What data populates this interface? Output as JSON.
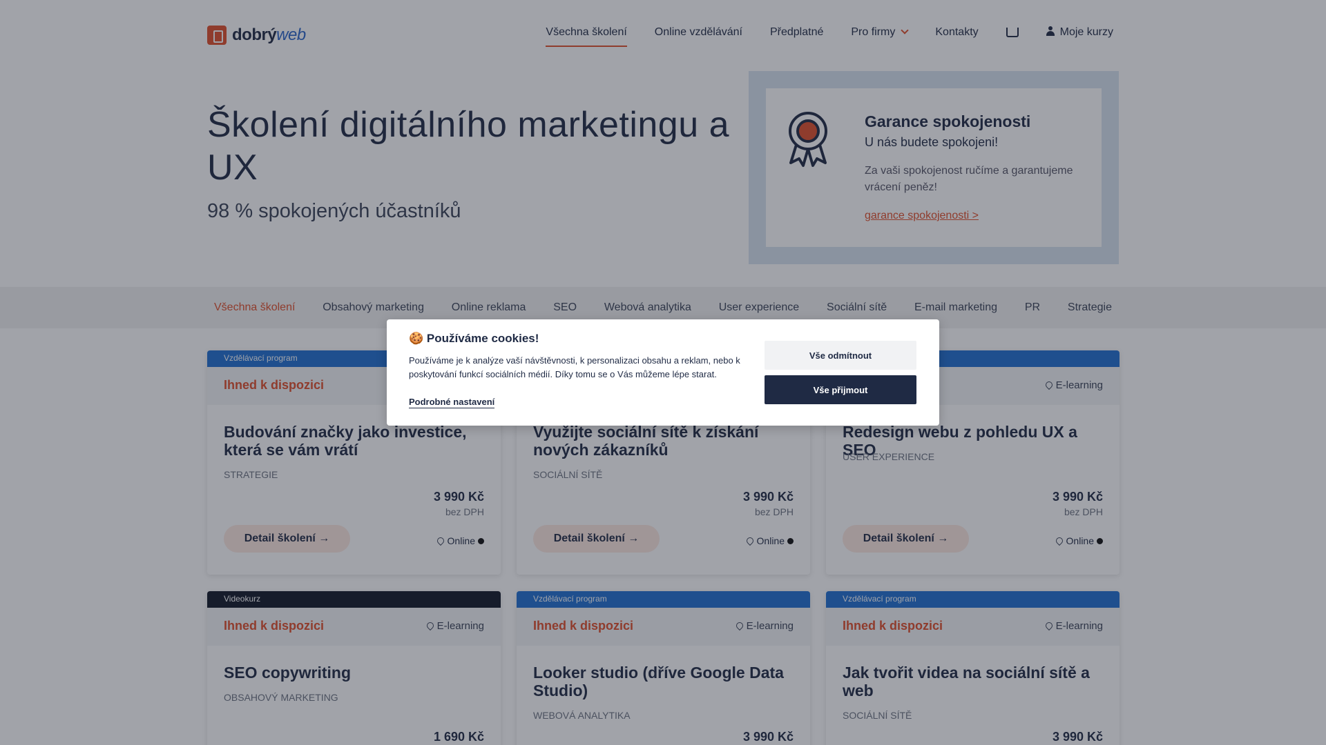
{
  "header": {
    "logo_main": "dobrý",
    "logo_accent": "web",
    "nav": [
      {
        "label": "Všechna školení"
      },
      {
        "label": "Online vzdělávání"
      },
      {
        "label": "Předplatné"
      },
      {
        "label": "Pro firmy"
      },
      {
        "label": "Kontakty"
      }
    ],
    "my_courses": "Moje kurzy"
  },
  "hero": {
    "title": "Školení digitálního marketingu a UX",
    "subtitle": "98 % spokojených účastníků"
  },
  "guarantee": {
    "title": "Garance spokojenosti",
    "subtitle": "U nás budete spokojeni!",
    "text": "Za vaši spokojenost ručíme a garantujeme vrácení peněz!",
    "link": "garance spokojenosti >"
  },
  "categories": [
    "Všechna školení",
    "Obsahový marketing",
    "Online reklama",
    "SEO",
    "Webová analytika",
    "User experience",
    "Sociální sítě",
    "E-mail marketing",
    "PR",
    "Strategie"
  ],
  "cards": [
    {
      "type": "Vzdělávací program",
      "availability": "Ihned k dispozici",
      "location": "",
      "title": "Budování značky jako investice, která se vám vrátí",
      "category": "Strategie",
      "price": "3 990 Kč",
      "vat": "bez DPH",
      "button": "Detail školení →",
      "mode": "Online"
    },
    {
      "type": "",
      "availability": "",
      "location": "",
      "title": "Využijte sociální sítě k získání nových zákazníků",
      "category": "Sociální sítě",
      "price": "3 990 Kč",
      "vat": "bez DPH",
      "button": "Detail školení →",
      "mode": "Online"
    },
    {
      "type": "",
      "availability": "",
      "location": "E-learning",
      "title": "Redesign webu z pohledu UX a SEO",
      "category": "User experience",
      "price": "3 990 Kč",
      "vat": "bez DPH",
      "button": "Detail školení →",
      "mode": "Online"
    },
    {
      "type": "Videokurz",
      "availability": "Ihned k dispozici",
      "location": "E-learning",
      "title": "SEO copywriting",
      "category": "Obsahový marketing",
      "price": "1 690 Kč"
    },
    {
      "type": "Vzdělávací program",
      "availability": "Ihned k dispozici",
      "location": "E-learning",
      "title": "Looker studio (dříve Google Data Studio)",
      "category": "Webová analytika",
      "price": "3 990 Kč"
    },
    {
      "type": "Vzdělávací program",
      "availability": "Ihned k dispozici",
      "location": "E-learning",
      "title": "Jak tvořit videa na sociální sítě a web",
      "category": "Sociální sítě",
      "price": "3 990 Kč"
    }
  ],
  "cookie": {
    "icon": "cookie-emoji",
    "emoji": "🍪",
    "title": "Používáme cookies!",
    "text": "Používáme je k analýze vaší návštěvnosti, k personalizaci obsahu a reklam, nebo k poskytování funkcí sociálních médií. Díky tomu se o Vás můžeme lépe starat.",
    "settings_link": "Podrobné nastavení",
    "reject": "Vše odmítnout",
    "accept": "Vše přijmout"
  },
  "colors": {
    "accent": "#e04e2a",
    "navy": "#1f2a44",
    "program_blue": "#1f6fd1"
  }
}
